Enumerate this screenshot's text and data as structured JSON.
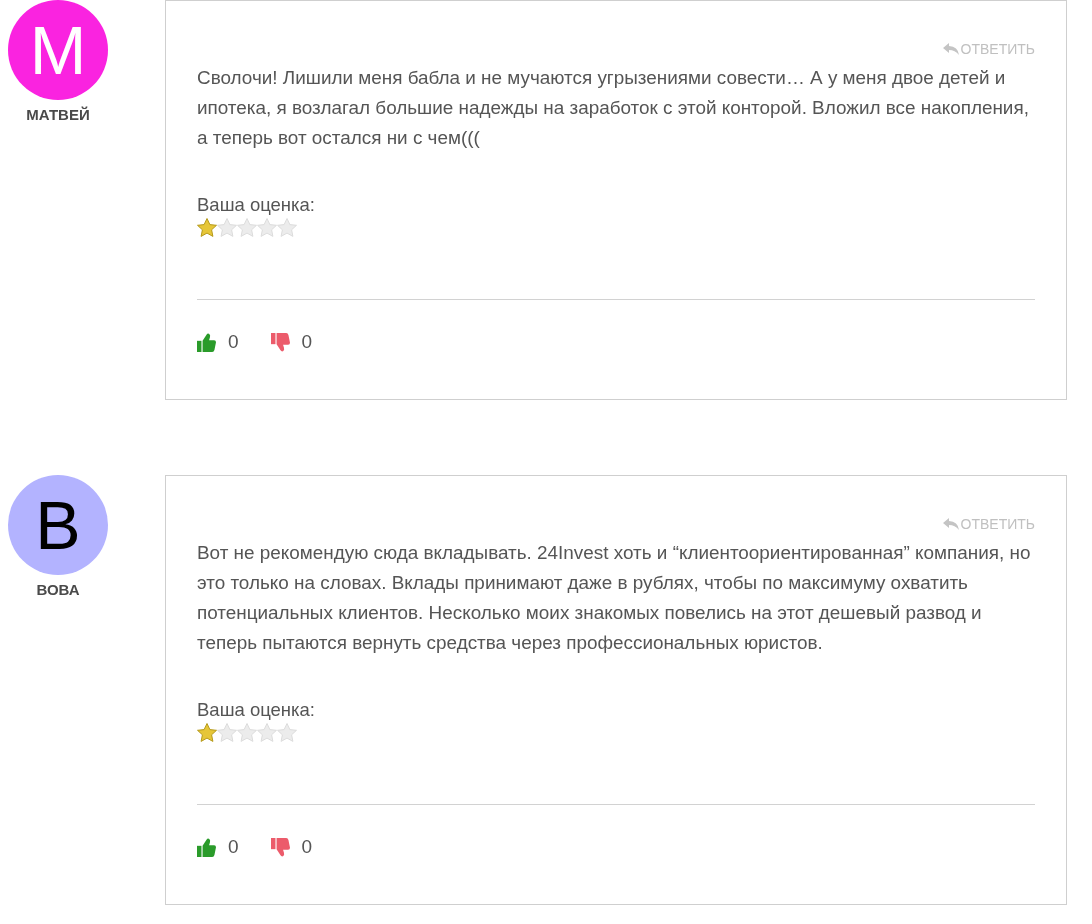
{
  "reviews": [
    {
      "author": "МАТВЕЙ",
      "avatar": {
        "letter": "М",
        "color": "#fa23e0"
      },
      "reply": "ОТВЕТИТЬ",
      "text": "Сволочи! Лишили меня бабла и не мучаются угрызениями совести… А у меня двое детей и ипотека, я возлагал большие надежды на заработок с этой конторой. Вложил все накопления, а теперь вот остался ни с чем(((",
      "rating_label": "Ваша оценка:",
      "stars": 1,
      "likes": "0",
      "dislikes": "0"
    },
    {
      "author": "ВОВА",
      "avatar": {
        "letter": "В",
        "color": "#b3b3ff"
      },
      "reply": "ОТВЕТИТЬ",
      "text": "Вот не рекомендую сюда вкладывать. 24Invest хоть и “клиентоориентированная” компания, но это только на словах. Вклады принимают даже в рублях, чтобы по максимуму охватить потенциальных клиентов. Несколько моих знакомых повелись на этот дешевый развод и теперь пытаются вернуть средства через профессиональных юристов.",
      "rating_label": "Ваша оценка:",
      "stars": 1,
      "likes": "0",
      "dislikes": "0"
    }
  ]
}
